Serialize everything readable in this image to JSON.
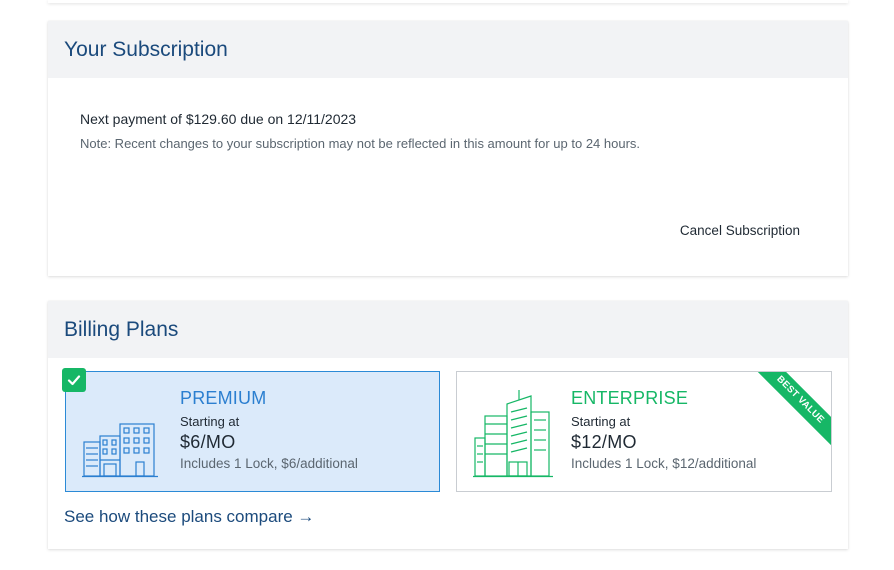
{
  "subscription": {
    "title": "Your Subscription",
    "next_payment": "Next payment of $129.60 due on 12/11/2023",
    "note": "Note: Recent changes to your subscription may not be reflected in this amount for up to 24 hours.",
    "cancel_label": "Cancel Subscription"
  },
  "billing": {
    "title": "Billing Plans",
    "plans": [
      {
        "name": "PREMIUM",
        "starting": "Starting at",
        "price": "$6/MO",
        "includes": "Includes 1 Lock, $6/additional",
        "selected": true,
        "icon": "buildings-blue-icon"
      },
      {
        "name": "ENTERPRISE",
        "starting": "Starting at",
        "price": "$12/MO",
        "includes": "Includes 1 Lock, $12/additional",
        "selected": false,
        "badge": "BEST VALUE",
        "icon": "skyscraper-green-icon"
      }
    ],
    "compare_label": "See how these plans compare →"
  },
  "colors": {
    "brand_blue": "#1b4a7c",
    "premium_blue": "#2b7fd0",
    "enterprise_green": "#16b766",
    "header_bg": "#f2f3f5",
    "selected_bg": "#dbeafa"
  }
}
